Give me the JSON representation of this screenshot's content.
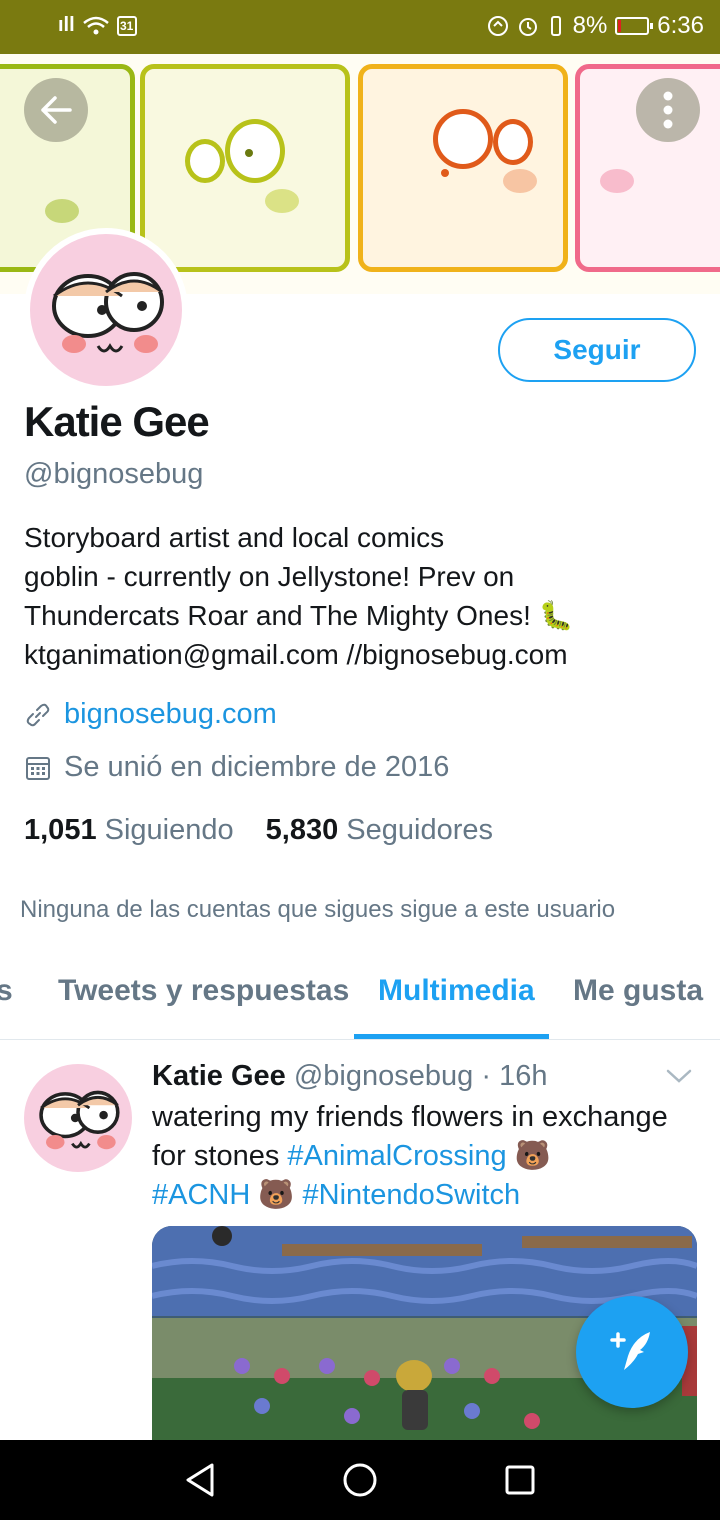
{
  "status_bar": {
    "signal": "ıll",
    "calendar_day": "31",
    "battery_percent": "8%",
    "time": "6:36",
    "battery_color": "#e02020"
  },
  "header": {
    "back_icon": "arrow-left-icon",
    "more_icon": "more-vertical-icon"
  },
  "profile": {
    "name": "Katie Gee",
    "handle": "@bignosebug",
    "follow_label": "Seguir",
    "bio_lines": [
      "Storyboard artist and local comics",
      "goblin - currently on Jellystone! Prev on",
      "Thundercats Roar and The Mighty Ones! 🐛",
      "ktganimation@gmail.com //bignosebug.com"
    ],
    "website": "bignosebug.com",
    "joined": "Se unió en diciembre de 2016",
    "following_count": "1,051",
    "following_label": "Siguiendo",
    "followers_count": "5,830",
    "followers_label": "Seguidores",
    "notice": "Ninguna de las cuentas que sigues sigue a este usuario"
  },
  "tabs": [
    {
      "label": "s"
    },
    {
      "label": "Tweets y respuestas"
    },
    {
      "label": "Multimedia"
    },
    {
      "label": "Me gusta"
    }
  ],
  "active_tab": "Multimedia",
  "tweet": {
    "name": "Katie Gee",
    "handle": "@bignosebug",
    "separator": "·",
    "time": "16h",
    "text_1": "watering my friends flowers in exchange for stones ",
    "tag_1": "#AnimalCrossing",
    "emoji_1": " 🐻",
    "tag_2": "#ACNH",
    "emoji_2": " 🐻 ",
    "tag_3": "#NintendoSwitch"
  },
  "colors": {
    "accent": "#1da1f2",
    "link": "#1b95e0",
    "status_bar": "#7a7a10",
    "muted": "#657786"
  }
}
